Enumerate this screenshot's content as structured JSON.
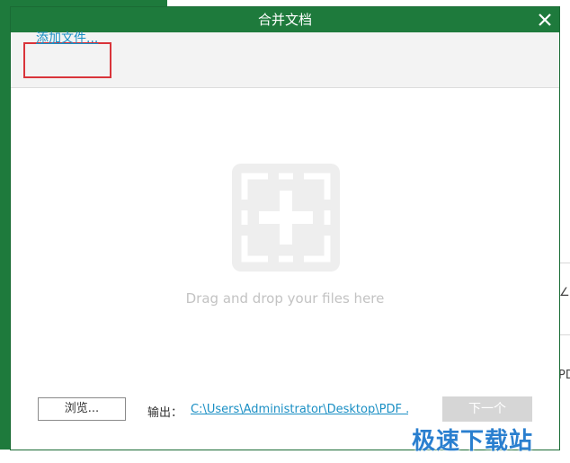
{
  "dialog": {
    "title": "合并文档",
    "close_icon": "close-icon",
    "add_file_label": "添加文件...",
    "drop_icon": "add-frame-icon",
    "drop_hint": "Drag and drop your files here",
    "browse_label": "浏览...",
    "output_label": "输出：",
    "output_path": "C:\\Users\\Administrator\\Desktop\\PDF ...",
    "next_label": "下一个",
    "next_enabled": false
  },
  "background": {
    "right_partial_text": "PDF"
  },
  "watermark": {
    "text": "极速下载站"
  },
  "colors": {
    "brand_green": "#1e7a3c",
    "link_blue": "#1a8fc4",
    "highlight_red": "#d9343a",
    "disabled_gray": "#d6d6d6"
  }
}
